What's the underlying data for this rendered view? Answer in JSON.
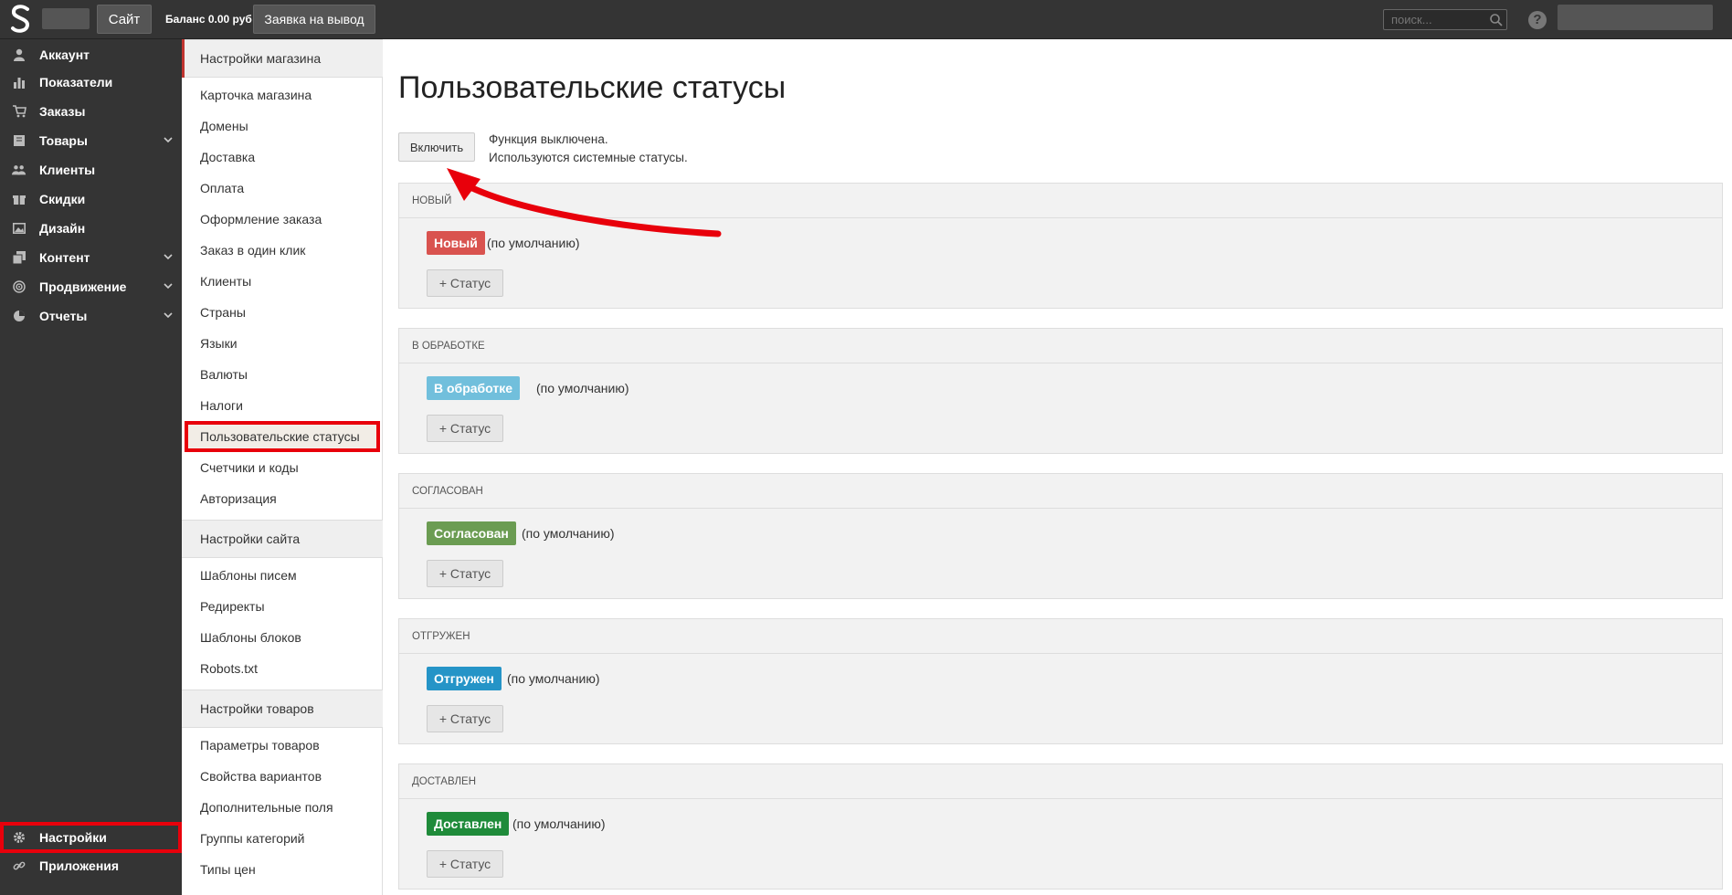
{
  "topbar": {
    "logo_icon": "logo-s-icon",
    "site_button": "Сайт",
    "balance": "Баланс 0.00 руб",
    "withdraw_button": "Заявка на вывод",
    "search_placeholder": "поиск...",
    "help_icon": "?"
  },
  "sidebar": {
    "items": [
      {
        "label": "Аккаунт",
        "icon": "user-icon"
      },
      {
        "label": "Показатели",
        "icon": "bar-chart-icon"
      },
      {
        "label": "Заказы",
        "icon": "cart-icon"
      },
      {
        "label": "Товары",
        "icon": "book-icon",
        "expandable": true
      },
      {
        "label": "Клиенты",
        "icon": "users-icon"
      },
      {
        "label": "Скидки",
        "icon": "gift-icon"
      },
      {
        "label": "Дизайн",
        "icon": "image-icon"
      },
      {
        "label": "Контент",
        "icon": "copy-icon",
        "expandable": true
      },
      {
        "label": "Продвижение",
        "icon": "target-icon",
        "expandable": true
      },
      {
        "label": "Отчеты",
        "icon": "pie-chart-icon",
        "expandable": true
      }
    ],
    "bottom": [
      {
        "label": "Настройки",
        "icon": "gear-icon"
      },
      {
        "label": "Приложения",
        "icon": "link-icon"
      }
    ]
  },
  "subnav": {
    "shop_header": "Настройки магазина",
    "shop_items": [
      "Карточка магазина",
      "Домены",
      "Доставка",
      "Оплата",
      "Оформление заказа",
      "Заказ в один клик",
      "Клиенты",
      "Страны",
      "Языки",
      "Валюты",
      "Налоги",
      "Пользовательские статусы",
      "Счетчики и коды",
      "Авторизация"
    ],
    "site_header": "Настройки сайта",
    "site_items": [
      "Шаблоны писем",
      "Редиректы",
      "Шаблоны блоков",
      "Robots.txt"
    ],
    "goods_header": "Настройки товаров",
    "goods_items": [
      "Параметры товаров",
      "Свойства вариантов",
      "Дополнительные поля",
      "Группы категорий",
      "Типы цен"
    ]
  },
  "main": {
    "title": "Пользовательские статусы",
    "enable_button": "Включить",
    "func_line1": "Функция выключена.",
    "func_line2": "Используются системные статусы.",
    "add_status_label": "Статус",
    "default_note": "(по умолчанию)",
    "panels": [
      {
        "head": "Новый",
        "badge": "Новый",
        "color": "#d9534f"
      },
      {
        "head": "В обработке",
        "badge": "В обработке",
        "color": "#71bfdc"
      },
      {
        "head": "Согласован",
        "badge": "Согласован",
        "color": "#6b9c52"
      },
      {
        "head": "Отгружен",
        "badge": "Отгружен",
        "color": "#2594c7"
      },
      {
        "head": "Доставлен",
        "badge": "Доставлен",
        "color": "#1f8b3a"
      }
    ]
  },
  "colors": {
    "highlight": "#e8000b",
    "sidebar_bg": "#343434"
  }
}
